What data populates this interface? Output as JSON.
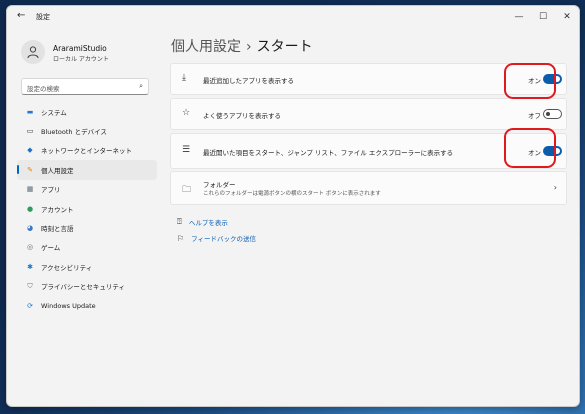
{
  "window": {
    "title": "設定",
    "back_icon": "back-arrow-icon",
    "controls": [
      "—",
      "☐",
      "✕"
    ]
  },
  "user": {
    "name": "AraramiStudio",
    "account_type": "ローカル アカウント"
  },
  "search": {
    "placeholder": "設定の検索"
  },
  "sidebar": {
    "items": [
      {
        "label": "システム",
        "icon": "monitor-icon",
        "color": "#1f7ad6"
      },
      {
        "label": "Bluetooth とデバイス",
        "icon": "bluetooth-icon",
        "color": "#2b2b2b"
      },
      {
        "label": "ネットワークとインターネット",
        "icon": "network-icon",
        "color": "#1a73c7"
      },
      {
        "label": "個人用設定",
        "icon": "brush-icon",
        "color": "#d98516",
        "active": true
      },
      {
        "label": "アプリ",
        "icon": "apps-icon",
        "color": "#5b6b7a"
      },
      {
        "label": "アカウント",
        "icon": "person-icon",
        "color": "#2e9d5a"
      },
      {
        "label": "時刻と言語",
        "icon": "globe-icon",
        "color": "#3a77c4"
      },
      {
        "label": "ゲーム",
        "icon": "gamepad-icon",
        "color": "#6b6b6b"
      },
      {
        "label": "アクセシビリティ",
        "icon": "accessibility-icon",
        "color": "#1a73c7"
      },
      {
        "label": "プライバシーとセキュリティ",
        "icon": "shield-icon",
        "color": "#6b7580"
      },
      {
        "label": "Windows Update",
        "icon": "update-icon",
        "color": "#1a73c7"
      }
    ]
  },
  "breadcrumb": {
    "parent": "個人用設定",
    "separator": "›",
    "current": "スタート"
  },
  "settings": [
    {
      "label": "最近追加したアプリを表示する",
      "icon": "download-icon",
      "state": "オン",
      "on": true
    },
    {
      "label": "よく使うアプリを表示する",
      "icon": "star-icon",
      "state": "オフ",
      "on": false
    },
    {
      "label": "最近開いた項目をスタート、ジャンプ リスト、ファイル エクスプローラーに表示する",
      "icon": "list-icon",
      "state": "オン",
      "on": true
    }
  ],
  "folders": {
    "label": "フォルダー",
    "description": "これらのフォルダーは電源ボタンの横のスタート ボタンに表示されます",
    "icon": "folder-icon"
  },
  "links": {
    "help": "ヘルプを表示",
    "feedback": "フィードバックの送信"
  },
  "colors": {
    "accent": "#0b5cab",
    "highlight": "#e0191f"
  }
}
